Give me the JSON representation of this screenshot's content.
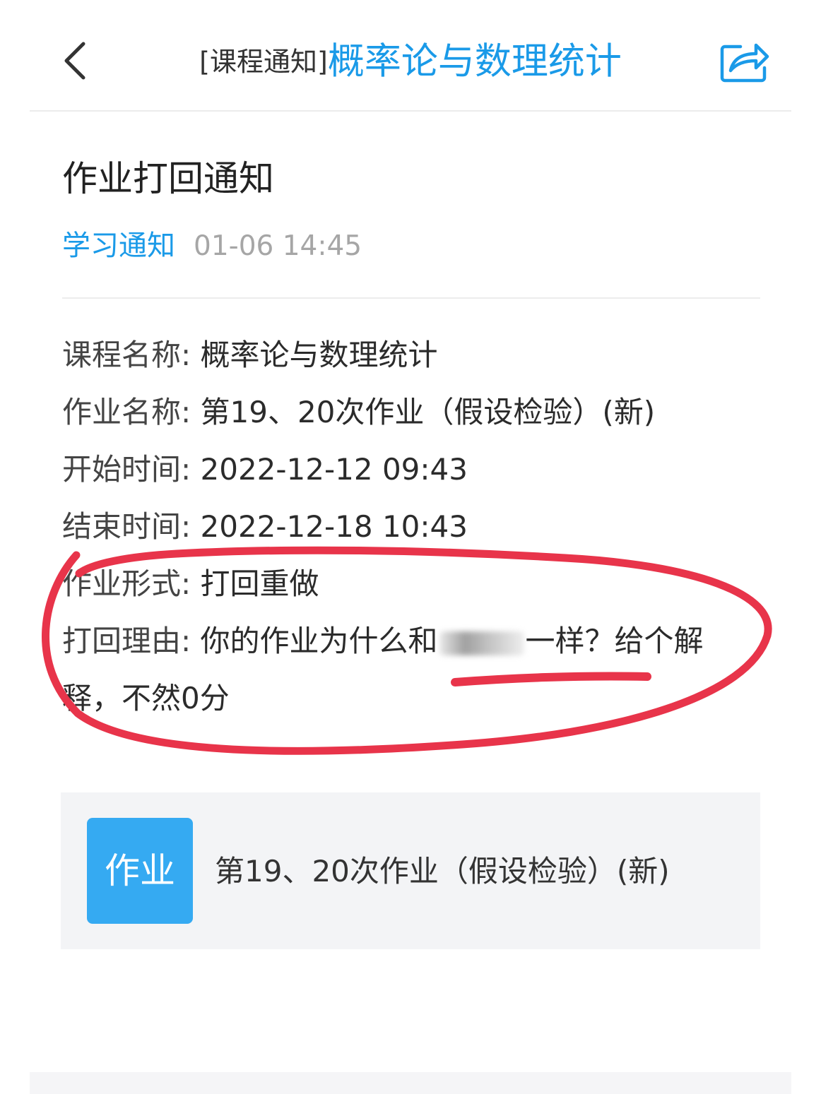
{
  "header": {
    "back_icon": "chevron-left-icon",
    "title_prefix": "[课程通知]",
    "title_course": "概率论与数理统计",
    "share_icon": "share-icon"
  },
  "notice": {
    "title": "作业打回通知",
    "category": "学习通知",
    "time": "01-06 14:45"
  },
  "details": {
    "course_label": "课程名称:",
    "course_value": "概率论与数理统计",
    "assignment_label": "作业名称:",
    "assignment_value": "第19、20次作业（假设检验）(新)",
    "start_label": "开始时间:",
    "start_value": "2022-12-12 09:43",
    "end_label": "结束时间:",
    "end_value": "2022-12-18 10:43",
    "form_label": "作业形式:",
    "form_value": "打回重做",
    "reason_label": "打回理由:",
    "reason_before": "你的作业为什么和",
    "reason_after": "一样？给个解释，不然0分"
  },
  "attachment": {
    "badge": "作业",
    "name": "第19、20次作业（假设检验）(新)"
  },
  "colors": {
    "accent": "#1a9ae8",
    "badge": "#35aaf2",
    "annotation": "#e8344a"
  }
}
